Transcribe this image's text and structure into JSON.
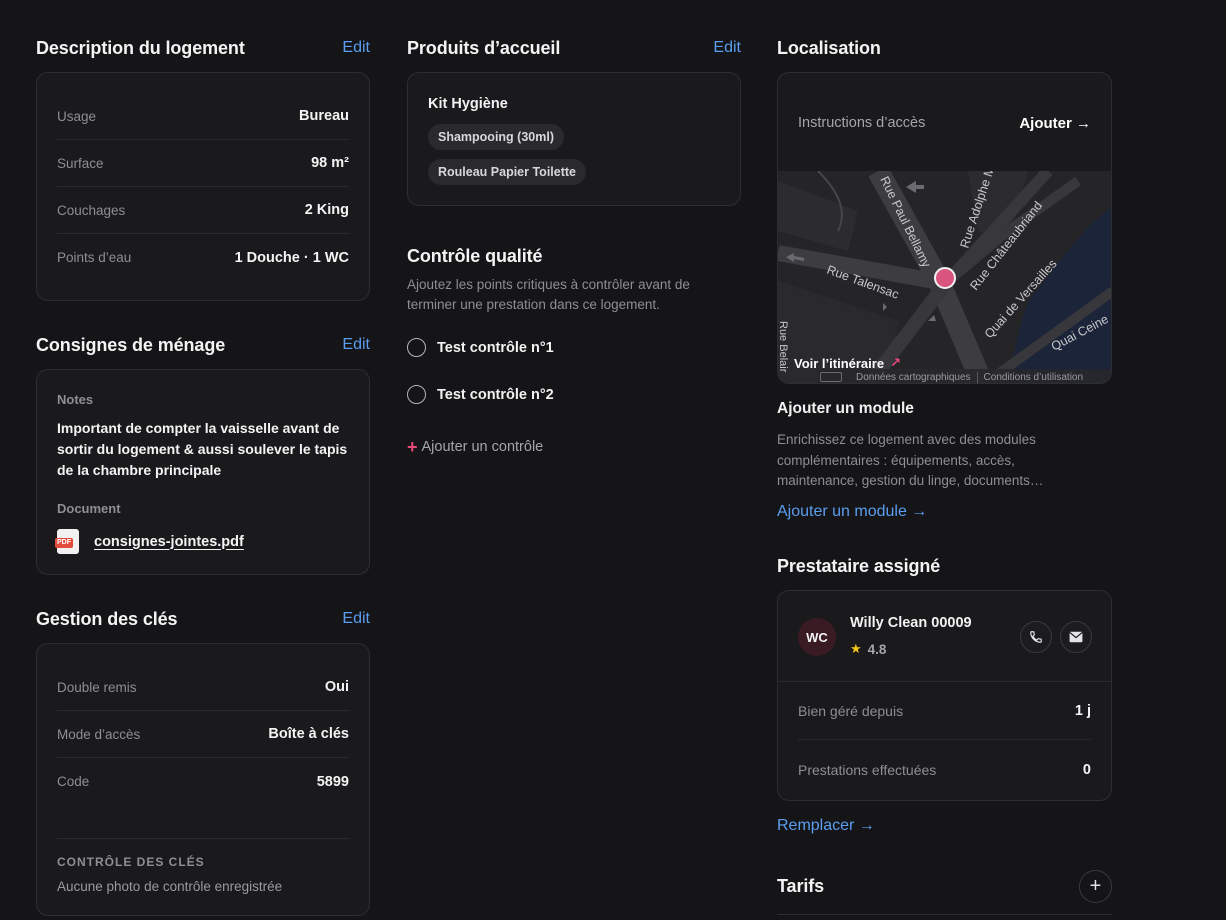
{
  "description": {
    "title": "Description du logement",
    "edit": "Edit",
    "rows": [
      {
        "label": "Usage",
        "value": "Bureau"
      },
      {
        "label": "Surface",
        "value": "98 m²"
      },
      {
        "label": "Couchages",
        "value": "2 King"
      },
      {
        "label": "Points d’eau",
        "value": "1 Douche · 1 WC"
      }
    ]
  },
  "consignes": {
    "title": "Consignes de ménage",
    "edit": "Edit",
    "notes_label": "Notes",
    "notes_text": "Important de compter la vaisselle avant de sortir du logement & aussi soulever le tapis de la chambre principale",
    "document_label": "Document",
    "document_name": "consignes-jointes.pdf",
    "pdf_badge": "PDF"
  },
  "cles": {
    "title": "Gestion des clés",
    "edit": "Edit",
    "rows": [
      {
        "label": "Double remis",
        "value": "Oui"
      },
      {
        "label": "Mode d’accès",
        "value": "Boîte à clés"
      },
      {
        "label": "Code",
        "value": "5899"
      }
    ],
    "controle_heading": "CONTRÔLE DES CLÉS",
    "controle_text": "Aucune photo de contrôle enregistrée"
  },
  "produits": {
    "title": "Produits d’accueil",
    "edit": "Edit",
    "kit_name": "Kit Hygiène",
    "items": [
      "Shampooing (30ml)",
      "Rouleau Papier Toilette"
    ]
  },
  "qualite": {
    "title": "Contrôle qualité",
    "description": "Ajoutez les points critiques à contrôler avant de terminer une prestation dans ce logement.",
    "checks": [
      "Test contrôle n°1",
      "Test contrôle n°2"
    ],
    "add_label": "Ajouter un contrôle"
  },
  "localisation": {
    "title": "Localisation",
    "instructions_label": "Instructions d’accès",
    "add_label": "Ajouter →",
    "map": {
      "streets": [
        "Rue Paul Bellamy",
        "Rue Adolphe Mo",
        "Rue Châteaubriand",
        "Rue Talensac",
        "Quai de Versailles",
        "Quai Ceine",
        "Rue Belair"
      ],
      "itinerary": "Voir l’itinéraire",
      "footer_data": "Données cartographiques",
      "footer_terms": "Conditions d’utilisation",
      "pin_color": "#d9557e"
    }
  },
  "module": {
    "title": "Ajouter un module",
    "description": "Enrichissez ce logement avec des modules complémentaires : équipements, accès, maintenance, gestion du linge, documents…",
    "link": "Ajouter un module →"
  },
  "prestataire": {
    "title": "Prestataire assigné",
    "initials": "WC",
    "name": "Willy Clean 00009",
    "rating": "4.8",
    "rows": [
      {
        "label": "Bien géré depuis",
        "value": "1 j"
      },
      {
        "label": "Prestations effectuées",
        "value": "0"
      }
    ],
    "replace_link": "Remplacer →"
  },
  "tarifs": {
    "title": "Tarifs"
  },
  "colors": {
    "background": "#151517",
    "card": "#1a1a1c",
    "accent_blue": "#5b9df0",
    "accent_pink": "#e8497a",
    "star": "#f5c518"
  }
}
